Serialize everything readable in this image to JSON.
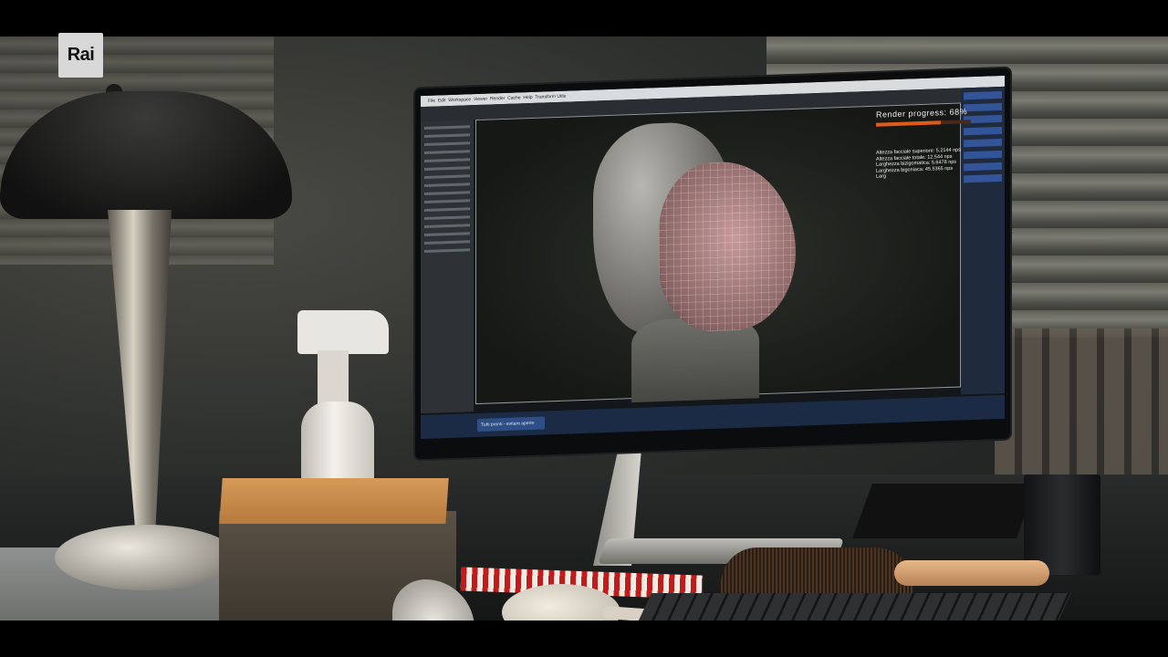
{
  "broadcaster": {
    "logo_text": "Rai"
  },
  "software": {
    "menu": [
      "File",
      "Edit",
      "Workspace",
      "Viewer",
      "Render",
      "Cache",
      "Help",
      "Transform Utils"
    ],
    "taskbar_item": "Tutti pronti - evitare aperto"
  },
  "render": {
    "progress_label": "Render progress:",
    "progress_value": "68%",
    "progress_fraction": 0.68,
    "measurements": [
      "Altezza facciale superiore: 5.2144 nps",
      "Altezza facciale totale: 12.544 nps",
      "Larghezza bizigomatica: 5.6478 nps",
      "Larghezza bigoniaca: 45.5365 nps",
      "Larg"
    ]
  },
  "colors": {
    "progress_fill": "#e05a1a",
    "taskbar": "#1c2b45",
    "logo_bg": "#d8d8d8"
  }
}
